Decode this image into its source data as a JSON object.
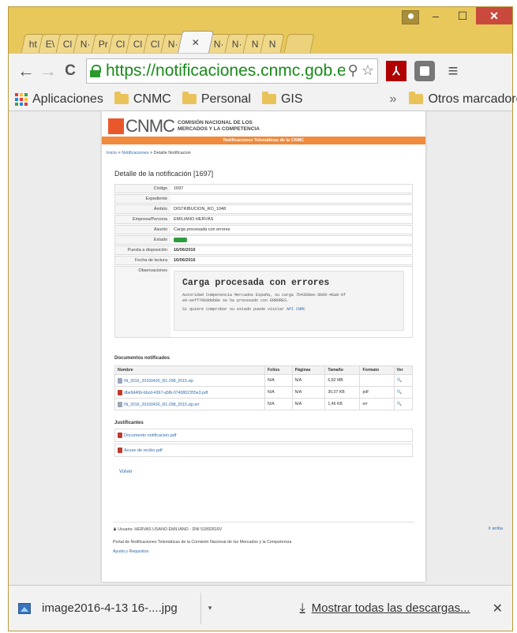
{
  "window": {
    "tabs": [
      "ht",
      "E\\",
      "Cl",
      "N·",
      "Pr",
      "Cl",
      "Cl",
      "Cl",
      "N·",
      "✕",
      "N·",
      "N·",
      "N",
      "N"
    ],
    "active_tab_close": "✕",
    "minimize": "–",
    "maximize": "☐",
    "close": "✕"
  },
  "toolbar": {
    "back": "←",
    "forward": "→",
    "reload": "C",
    "url": "https://notificaciones.cnmc.gob.e",
    "zoom_icon": "⚲",
    "star_icon": "☆",
    "pdf_ext_label": "⅄",
    "menu_icon": "≡"
  },
  "bookmarks": {
    "apps": "Aplicaciones",
    "items": [
      "CNMC",
      "Personal",
      "GIS"
    ],
    "overflow": "»",
    "other": "Otros marcadores"
  },
  "page": {
    "logo_text": "CNMC",
    "logo_sub_line1": "COMISIÓN NACIONAL DE LOS",
    "logo_sub_line2": "MERCADOS Y LA COMPETENCIA",
    "banner": "Notificaciones Telemáticas de la CNMC",
    "breadcrumb": {
      "home": "Inicio",
      "sep1": " > ",
      "notifs": "Notificaciones",
      "sep2": " > ",
      "current": "Detalle Notificacion"
    },
    "detail_title": "Detalle de la notificación [1697]",
    "fields": [
      {
        "key": "Código",
        "value": "1697"
      },
      {
        "key": "Expediente",
        "value": ""
      },
      {
        "key": "Ámbito",
        "value": "DISTRIBUCION_RO_1048"
      },
      {
        "key": "Empresa/Persona",
        "value": "EMILIANO HERVÁS"
      },
      {
        "key": "Asunto",
        "value": "Carga procesada con errores"
      }
    ],
    "estado_key": "Estado",
    "estado_value": "Leída",
    "puesta_key": "Puesta a disposición",
    "puesta_value": "16/06/2016",
    "lectura_key": "Fecha de lectura",
    "lectura_value": "16/06/2016",
    "obs_key": "Observaciones",
    "obs_title": "Carga procesada con errores",
    "obs_line1": "Autoridad Competencia Mercados España, su carga 7b4368ee-3b09-46a0-9f",
    "obs_line2": "e9-eeff796ddeb8e se ha procesado con ERRORES.",
    "obs_line3": "Si quiere comprobar su estado puede visitar",
    "obs_link": "API CNMC",
    "docs_title": "Documentos notificados",
    "docs_headers": [
      "Nombre",
      "Folios",
      "Páginas",
      "Tamaño",
      "Formato",
      "Ver"
    ],
    "docs": [
      {
        "name": "IN_2016_20160430_R1-298_2015.zip",
        "icon": "doc",
        "folios": "N/A",
        "paginas": "N/A",
        "tamano": "6,82 MB",
        "formato": "",
        "ver": "🔍"
      },
      {
        "name": "dbe9d40b-bbcd-4367-a5fb-0740802355e3.pdf",
        "icon": "pdf",
        "folios": "N/A",
        "paginas": "N/A",
        "tamano": "30,07 KB",
        "formato": "pdf",
        "ver": "🔍"
      },
      {
        "name": "IN_2016_20160430_R1-298_2015.zip.err",
        "icon": "doc",
        "folios": "N/A",
        "paginas": "N/A",
        "tamano": "1,46 KB",
        "formato": "err",
        "ver": "🔍"
      }
    ],
    "justif_title": "Justificantes",
    "justificantes": [
      "Documento notificacion.pdf",
      "Acuse de recibo.pdf"
    ],
    "volver": "Volver",
    "footer_user": "♟ Usuario: HERVAS USANO EMILIANO - DNI 51892816V",
    "footer_portal": "Portal de Notificaciones Telemáticas de la Comisión Nacional de los Mercados y la Competencia",
    "footer_help": "Ayuda y Requisitos",
    "ir_arriba": "Ir arriba"
  },
  "downloads": {
    "file": "image2016-4-13 16-....jpg",
    "arrow": "▾",
    "show_all": "Mostrar todas las descargas...",
    "show_all_icon": "⤓",
    "close": "✕"
  },
  "colors": {
    "window_frame": "#e8c85a",
    "url_green": "#1a8a1a",
    "cnmc_orange": "#e9582b",
    "banner_orange": "#f08a3c",
    "link_blue": "#2b6cb0"
  }
}
